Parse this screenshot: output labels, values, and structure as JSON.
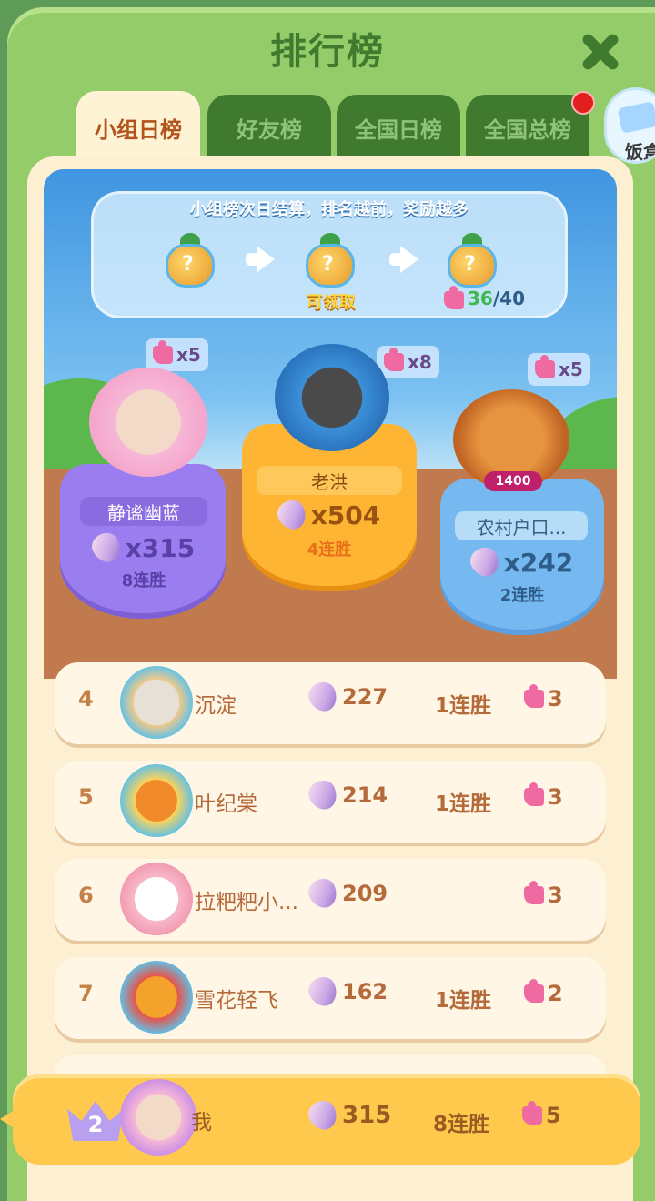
{
  "title": "排行榜",
  "tabs": [
    {
      "label": "小组日榜",
      "active": true
    },
    {
      "label": "好友榜",
      "active": false
    },
    {
      "label": "全国日榜",
      "active": false
    },
    {
      "label": "全国总榜",
      "active": false
    }
  ],
  "side_gift_label": "饭盒",
  "reward_info": {
    "text": "小组榜次日结算，排名越前，奖励越多",
    "claim_label": "可领取",
    "progress_current": "36",
    "progress_total": "/40"
  },
  "podium": [
    {
      "rank": 2,
      "name": "静谧幽蓝",
      "score": "x315",
      "streak": "8连胜",
      "pieces": "x5"
    },
    {
      "rank": 1,
      "name": "老洪",
      "score": "x504",
      "streak": "4连胜",
      "pieces": "x8"
    },
    {
      "rank": 3,
      "name": "农村户口...",
      "score": "x242",
      "streak": "2连胜",
      "pieces": "x5",
      "badge": "1400"
    }
  ],
  "rows": [
    {
      "rank": "4",
      "name": "沉淀",
      "score": "227",
      "streak": "1连胜",
      "pieces": "3"
    },
    {
      "rank": "5",
      "name": "叶纪棠",
      "score": "214",
      "streak": "1连胜",
      "pieces": "3"
    },
    {
      "rank": "6",
      "name": "拉粑粑小...",
      "score": "209",
      "streak": "",
      "pieces": "3"
    },
    {
      "rank": "7",
      "name": "雪花轻飞",
      "score": "162",
      "streak": "1连胜",
      "pieces": "2"
    }
  ],
  "me": {
    "rank": "2",
    "name": "我",
    "score": "315",
    "streak": "8连胜",
    "pieces": "5"
  },
  "colors": {
    "frame": "#94cc6a",
    "tab_dark": "#3f7a2f",
    "panel": "#fdf0d2",
    "row_text": "#b46a3a",
    "me_bar": "#ffc94d"
  }
}
